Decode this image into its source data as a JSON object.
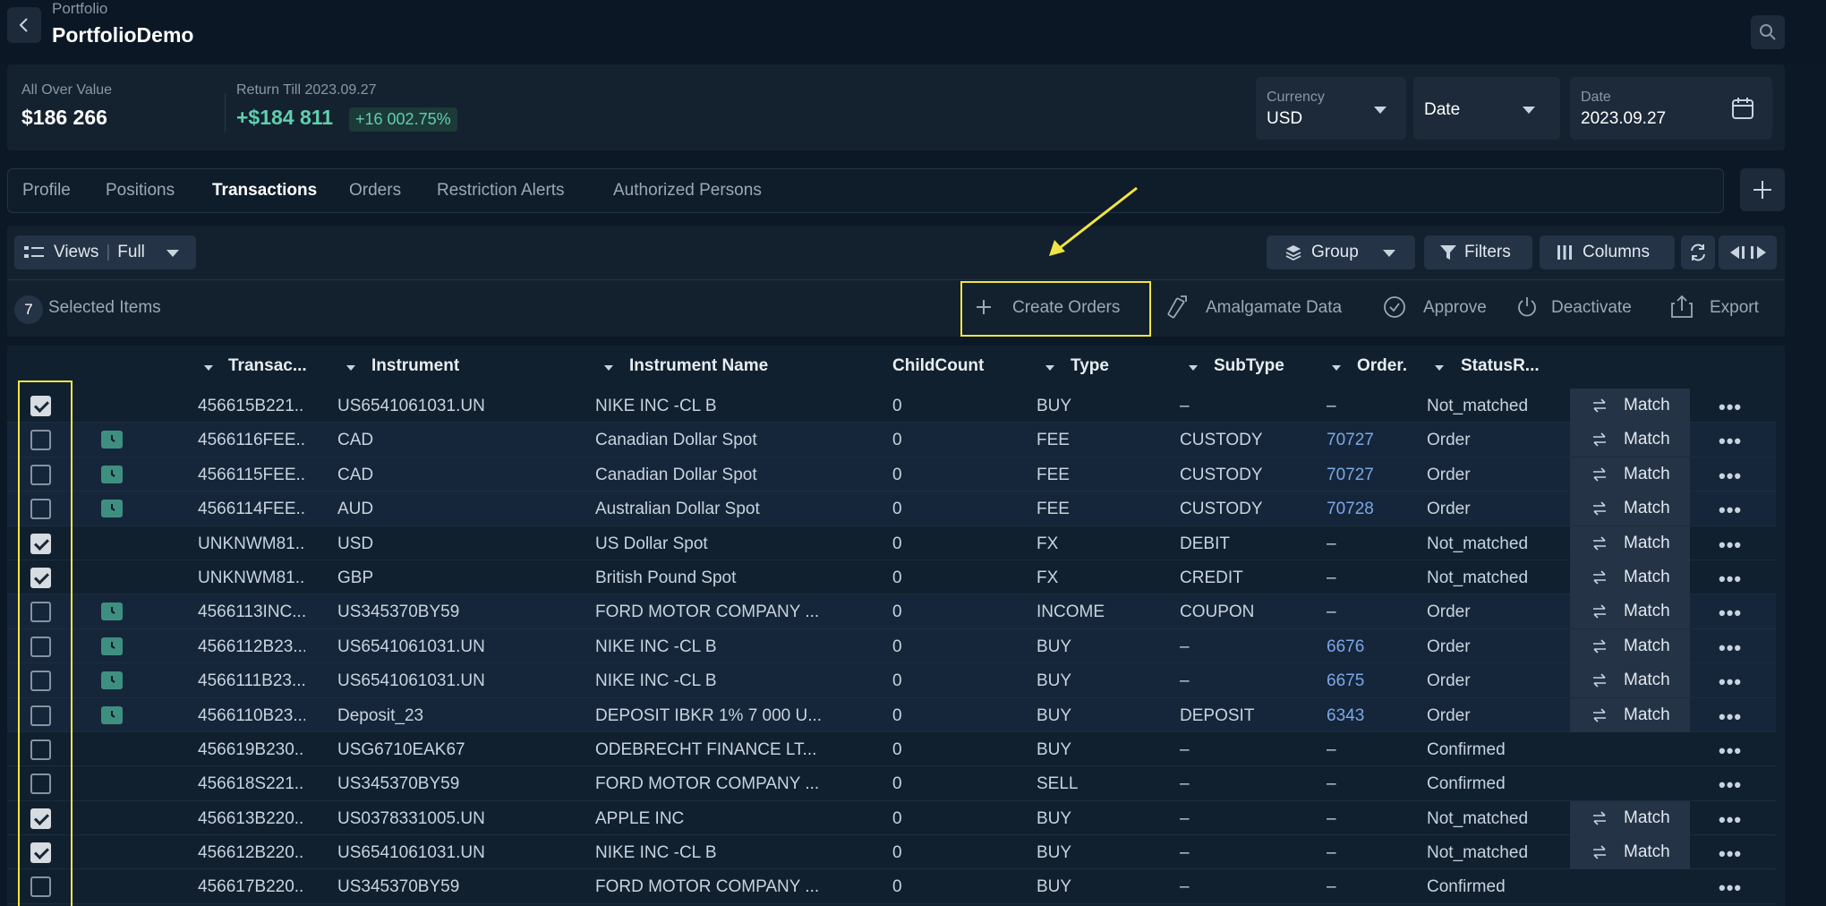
{
  "header": {
    "breadcrumb": "Portfolio",
    "title": "PortfolioDemo",
    "back_icon": "chevron-left-icon",
    "search_icon": "search-icon"
  },
  "summary": {
    "overall_label": "All Over Value",
    "overall_value": "$186 266",
    "return_label": "Return Till 2023.09.27",
    "return_value": "+$184 811",
    "return_pct": "+16 002.75%",
    "currency_label": "Currency",
    "currency_value": "USD",
    "date_mode_value": "Date",
    "date_label": "Date",
    "date_value": "2023.09.27"
  },
  "tabs": [
    "Profile",
    "Positions",
    "Transactions",
    "Orders",
    "Restriction Alerts",
    "Authorized Persons"
  ],
  "active_tab": "Transactions",
  "toolbar": {
    "views_label": "Views",
    "views_value": "Full",
    "group_label": "Group",
    "filters_label": "Filters",
    "columns_label": "Columns"
  },
  "selection": {
    "count": "7",
    "label": "Selected Items"
  },
  "actions": {
    "create_orders": "Create Orders",
    "amalgamate": "Amalgamate Data",
    "approve": "Approve",
    "deactivate": "Deactivate",
    "export": "Export"
  },
  "columns": [
    "Transac...",
    "Instrument",
    "Instrument Name",
    "ChildCount",
    "Type",
    "SubType",
    "Order.",
    "StatusR..."
  ],
  "match_label": "Match",
  "rows": [
    {
      "checked": true,
      "clock": false,
      "id": "456615B221...",
      "instrument": "US6541061031.UN",
      "name": "NIKE INC -CL B",
      "child": "0",
      "type": "BUY",
      "subtype": "–",
      "order": "–",
      "order_link": false,
      "status": "Not_matched",
      "match": true
    },
    {
      "checked": false,
      "clock": true,
      "id": "4566116FEE...",
      "instrument": "CAD",
      "name": "Canadian Dollar Spot",
      "child": "0",
      "type": "FEE",
      "subtype": "CUSTODY",
      "order": "70727",
      "order_link": true,
      "status": "Order",
      "match": true
    },
    {
      "checked": false,
      "clock": true,
      "id": "4566115FEE...",
      "instrument": "CAD",
      "name": "Canadian Dollar Spot",
      "child": "0",
      "type": "FEE",
      "subtype": "CUSTODY",
      "order": "70727",
      "order_link": true,
      "status": "Order",
      "match": true
    },
    {
      "checked": false,
      "clock": true,
      "id": "4566114FEE...",
      "instrument": "AUD",
      "name": "Australian Dollar Spot",
      "child": "0",
      "type": "FEE",
      "subtype": "CUSTODY",
      "order": "70728",
      "order_link": true,
      "status": "Order",
      "match": true
    },
    {
      "checked": true,
      "clock": false,
      "id": "UNKNWM81...",
      "instrument": "USD",
      "name": "US Dollar Spot",
      "child": "0",
      "type": "FX",
      "subtype": "DEBIT",
      "order": "–",
      "order_link": false,
      "status": "Not_matched",
      "match": true
    },
    {
      "checked": true,
      "clock": false,
      "id": "UNKNWM81...",
      "instrument": "GBP",
      "name": "British Pound Spot",
      "child": "0",
      "type": "FX",
      "subtype": "CREDIT",
      "order": "–",
      "order_link": false,
      "status": "Not_matched",
      "match": true
    },
    {
      "checked": false,
      "clock": true,
      "id": "4566113INC...",
      "instrument": "US345370BY59",
      "name": "FORD MOTOR COMPANY ...",
      "child": "0",
      "type": "INCOME",
      "subtype": "COUPON",
      "order": "–",
      "order_link": false,
      "status": "Order",
      "match": true
    },
    {
      "checked": false,
      "clock": true,
      "id": "4566112B23...",
      "instrument": "US6541061031.UN",
      "name": "NIKE INC -CL B",
      "child": "0",
      "type": "BUY",
      "subtype": "–",
      "order": "6676",
      "order_link": true,
      "status": "Order",
      "match": true
    },
    {
      "checked": false,
      "clock": true,
      "id": "4566111B23...",
      "instrument": "US6541061031.UN",
      "name": "NIKE INC -CL B",
      "child": "0",
      "type": "BUY",
      "subtype": "–",
      "order": "6675",
      "order_link": true,
      "status": "Order",
      "match": true
    },
    {
      "checked": false,
      "clock": true,
      "id": "4566110B23...",
      "instrument": "Deposit_23",
      "name": "DEPOSIT IBKR 1% 7 000 U...",
      "child": "0",
      "type": "BUY",
      "subtype": "DEPOSIT",
      "order": "6343",
      "order_link": true,
      "status": "Order",
      "match": true
    },
    {
      "checked": false,
      "clock": false,
      "id": "456619B230...",
      "instrument": "USG6710EAK67",
      "name": "ODEBRECHT FINANCE LT...",
      "child": "0",
      "type": "BUY",
      "subtype": "–",
      "order": "–",
      "order_link": false,
      "status": "Confirmed",
      "match": false
    },
    {
      "checked": false,
      "clock": false,
      "id": "456618S221...",
      "instrument": "US345370BY59",
      "name": "FORD MOTOR COMPANY ...",
      "child": "0",
      "type": "SELL",
      "subtype": "–",
      "order": "–",
      "order_link": false,
      "status": "Confirmed",
      "match": false
    },
    {
      "checked": true,
      "clock": false,
      "id": "456613B220...",
      "instrument": "US0378331005.UN",
      "name": "APPLE INC",
      "child": "0",
      "type": "BUY",
      "subtype": "–",
      "order": "–",
      "order_link": false,
      "status": "Not_matched",
      "match": true
    },
    {
      "checked": true,
      "clock": false,
      "id": "456612B220...",
      "instrument": "US6541061031.UN",
      "name": "NIKE INC -CL B",
      "child": "0",
      "type": "BUY",
      "subtype": "–",
      "order": "–",
      "order_link": false,
      "status": "Not_matched",
      "match": true
    },
    {
      "checked": false,
      "clock": false,
      "id": "456617B220...",
      "instrument": "US345370BY59",
      "name": "FORD MOTOR COMPANY ...",
      "child": "0",
      "type": "BUY",
      "subtype": "–",
      "order": "–",
      "order_link": false,
      "status": "Confirmed",
      "match": false
    }
  ],
  "colors": {
    "background": "#0c1826",
    "panel": "#14212f",
    "accent_green": "#5fd0ad",
    "link_blue": "#7da7e6",
    "highlight_yellow": "#f0e542",
    "clock_teal": "#3f8f80"
  }
}
